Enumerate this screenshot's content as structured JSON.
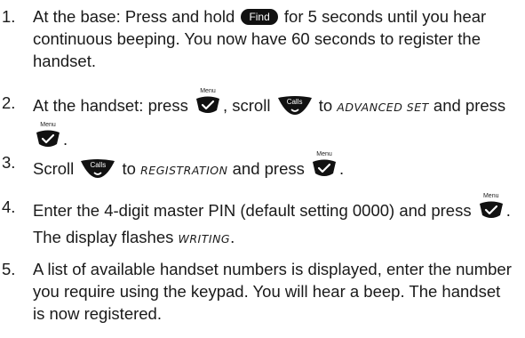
{
  "steps": [
    {
      "number": "1.",
      "t1": "At the base: Press and hold",
      "key_find": "Find",
      "t2": "for 5 seconds until you hear continuous beeping. You now have 60 seconds to register the handset."
    },
    {
      "number": "2.",
      "t1": "At the handset: press",
      "key_menu_1": "Menu",
      "t2": ", scroll",
      "key_calls": "Calls",
      "t3": "to",
      "lcd": "ADVANCED SET",
      "t4": "and press",
      "key_menu_2": "Menu",
      "t5": "."
    },
    {
      "number": "3.",
      "t1": "Scroll",
      "key_calls": "Calls",
      "t2": "to",
      "lcd": "REGISTRATION",
      "t3": "and press",
      "key_menu": "Menu",
      "t4": "."
    },
    {
      "number": "4.",
      "t1": "Enter the 4-digit master PIN (default setting 0000) and press",
      "key_menu": "Menu",
      "t2": ". The display flashes",
      "lcd": "WRITING",
      "t3": "."
    },
    {
      "number": "5.",
      "t1": "A list of available handset numbers is displayed, enter the number you require using the keypad. You will hear a beep. The handset is now registered."
    }
  ],
  "icons": {
    "find": "find-key-icon",
    "menu": "menu-ok-key-icon",
    "calls": "calls-scroll-key-icon"
  },
  "colors": {
    "text": "#1a1a1a",
    "key": "#111111"
  }
}
